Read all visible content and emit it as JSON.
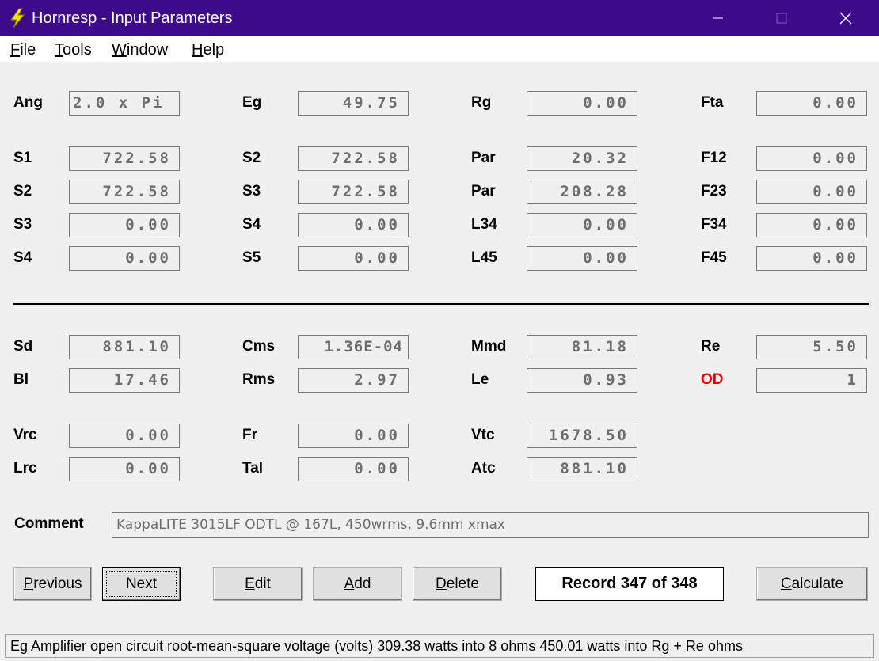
{
  "window": {
    "title": "Hornresp - Input Parameters"
  },
  "menu": [
    "File",
    "Tools",
    "Window",
    "Help"
  ],
  "params": {
    "ang": {
      "label": "Ang",
      "value": "2.0 x Pi"
    },
    "eg": {
      "label": "Eg",
      "value": "49.75"
    },
    "rg": {
      "label": "Rg",
      "value": "0.00"
    },
    "fta": {
      "label": "Fta",
      "value": "0.00"
    },
    "s1": {
      "label": "S1",
      "value": "722.58"
    },
    "s2a": {
      "label": "S2",
      "value": "722.58"
    },
    "par1": {
      "label": "Par",
      "value": "20.32"
    },
    "f12": {
      "label": "F12",
      "value": "0.00"
    },
    "s2b": {
      "label": "S2",
      "value": "722.58"
    },
    "s3a": {
      "label": "S3",
      "value": "722.58"
    },
    "par2": {
      "label": "Par",
      "value": "208.28"
    },
    "f23": {
      "label": "F23",
      "value": "0.00"
    },
    "s3b": {
      "label": "S3",
      "value": "0.00"
    },
    "s4a": {
      "label": "S4",
      "value": "0.00"
    },
    "l34": {
      "label": "L34",
      "value": "0.00"
    },
    "f34": {
      "label": "F34",
      "value": "0.00"
    },
    "s4b": {
      "label": "S4",
      "value": "0.00"
    },
    "s5": {
      "label": "S5",
      "value": "0.00"
    },
    "l45": {
      "label": "L45",
      "value": "0.00"
    },
    "f45": {
      "label": "F45",
      "value": "0.00"
    },
    "sd": {
      "label": "Sd",
      "value": "881.10"
    },
    "cms": {
      "label": "Cms",
      "value": "1.36E-04"
    },
    "mmd": {
      "label": "Mmd",
      "value": "81.18"
    },
    "re": {
      "label": "Re",
      "value": "5.50"
    },
    "bl": {
      "label": "Bl",
      "value": "17.46"
    },
    "rms": {
      "label": "Rms",
      "value": "2.97"
    },
    "le": {
      "label": "Le",
      "value": "0.93"
    },
    "od": {
      "label": "OD",
      "value": "1"
    },
    "vrc": {
      "label": "Vrc",
      "value": "0.00"
    },
    "fr": {
      "label": "Fr",
      "value": "0.00"
    },
    "vtc": {
      "label": "Vtc",
      "value": "1678.50"
    },
    "lrc": {
      "label": "Lrc",
      "value": "0.00"
    },
    "tal": {
      "label": "Tal",
      "value": "0.00"
    },
    "atc": {
      "label": "Atc",
      "value": "881.10"
    }
  },
  "comment": {
    "label": "Comment",
    "value": "KappaLITE 3015LF ODTL @ 167L, 450wrms, 9.6mm xmax"
  },
  "buttons": {
    "previous": "Previous",
    "next": "Next",
    "edit": "Edit",
    "add": "Add",
    "delete": "Delete",
    "calculate": "Calculate"
  },
  "record": "Record 347 of 348",
  "status": "Eg  Amplifier open circuit root-mean-square voltage  (volts)   309.38 watts into 8 ohms   450.01 watts into Rg + Re ohms",
  "colors": {
    "titlebar": "#3c0a8a",
    "od_label": "#e00000",
    "icon": "#f2e600"
  }
}
